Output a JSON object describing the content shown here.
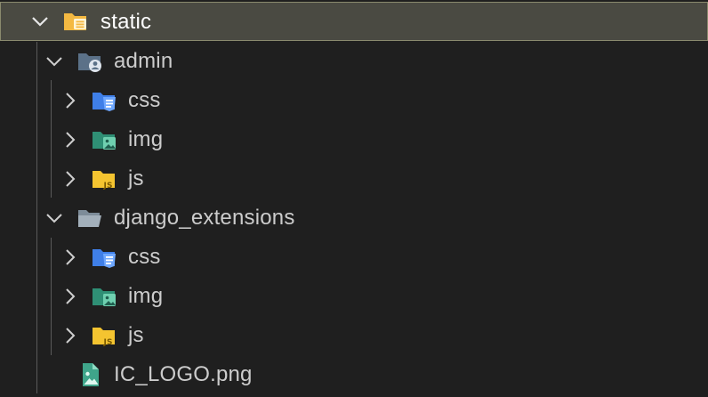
{
  "tree": {
    "root": {
      "label": "static",
      "expanded": true,
      "icon": "static-folder-icon"
    },
    "admin": {
      "label": "admin",
      "expanded": true,
      "icon": "admin-folder-icon"
    },
    "admin_css": {
      "label": "css",
      "icon": "css-folder-icon"
    },
    "admin_img": {
      "label": "img",
      "icon": "images-folder-icon"
    },
    "admin_js": {
      "label": "js",
      "icon": "js-folder-icon"
    },
    "django_extensions": {
      "label": "django_extensions",
      "expanded": true,
      "icon": "folder-open-icon"
    },
    "de_css": {
      "label": "css",
      "icon": "css-folder-icon"
    },
    "de_img": {
      "label": "img",
      "icon": "images-folder-icon"
    },
    "de_js": {
      "label": "js",
      "icon": "js-folder-icon"
    },
    "logo_file": {
      "label": "IC_LOGO.png",
      "icon": "image-file-icon"
    }
  },
  "colors": {
    "background": "#1f1f1f",
    "selected_background": "#4a4a42",
    "selected_border": "#8a8a6e",
    "text": "#cccccc",
    "css_folder": "#4f8ff7",
    "img_folder": "#3fa58a",
    "js_folder": "#f4c430",
    "static_folder": "#f4b942"
  }
}
